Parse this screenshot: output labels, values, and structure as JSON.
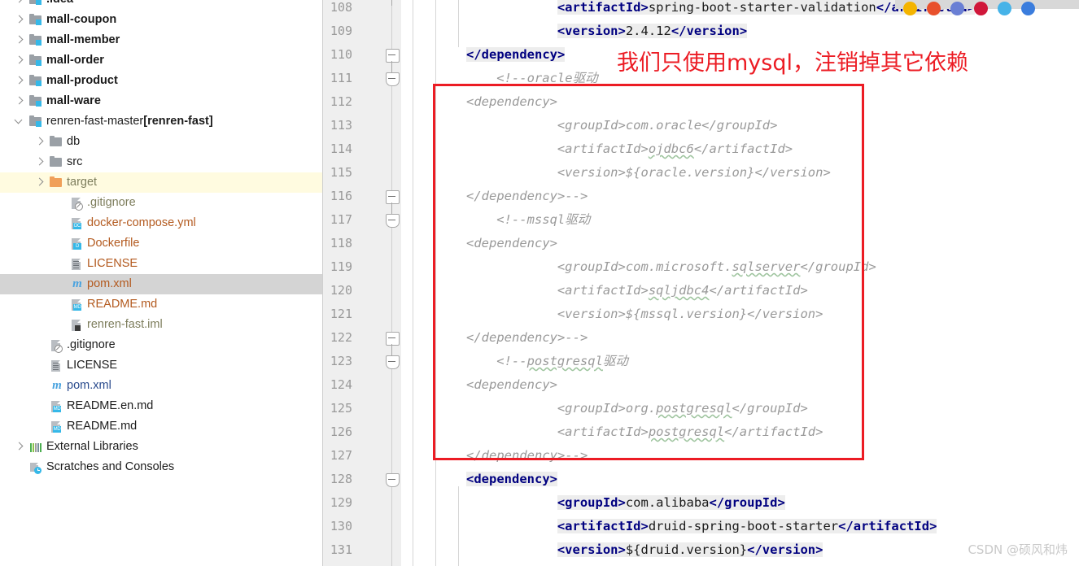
{
  "sidebar": {
    "rows": [
      {
        "label": ".idea",
        "indent": 0,
        "icon": "folder-module-icon",
        "arrow": "closed",
        "style": "bold-dark",
        "state": "clipped"
      },
      {
        "label": "mall-coupon",
        "indent": 0,
        "icon": "folder-module-icon",
        "arrow": "closed",
        "style": "bold-dark",
        "state": "normal"
      },
      {
        "label": "mall-member",
        "indent": 0,
        "icon": "folder-module-icon",
        "arrow": "closed",
        "style": "bold-dark",
        "state": "normal"
      },
      {
        "label": "mall-order",
        "indent": 0,
        "icon": "folder-module-icon",
        "arrow": "closed",
        "style": "bold-dark",
        "state": "normal"
      },
      {
        "label": "mall-product",
        "indent": 0,
        "icon": "folder-module-icon",
        "arrow": "closed",
        "style": "bold-dark",
        "state": "normal"
      },
      {
        "label": "mall-ware",
        "indent": 0,
        "icon": "folder-module-icon",
        "arrow": "closed",
        "style": "bold-dark",
        "state": "normal"
      },
      {
        "label": "renren-fast-master ",
        "suffix": "[renren-fast]",
        "indent": 0,
        "icon": "folder-module-icon",
        "arrow": "open",
        "style": "dark-suffix-bold",
        "state": "normal"
      },
      {
        "label": "db",
        "indent": 1,
        "icon": "folder-icon",
        "arrow": "closed",
        "style": "dark",
        "state": "normal"
      },
      {
        "label": "src",
        "indent": 1,
        "icon": "folder-icon",
        "arrow": "closed",
        "style": "dark",
        "state": "normal"
      },
      {
        "label": "target",
        "indent": 1,
        "icon": "folder-orange-icon",
        "arrow": "closed",
        "style": "olive",
        "state": "highlighted"
      },
      {
        "label": ".gitignore",
        "indent": 2,
        "icon": "gitignore-file-icon",
        "arrow": "none",
        "style": "olive",
        "state": "normal"
      },
      {
        "label": "docker-compose.yml",
        "indent": 2,
        "icon": "docker-compose-file-icon",
        "badge": "DC",
        "arrow": "none",
        "style": "orange",
        "state": "normal"
      },
      {
        "label": "Dockerfile",
        "indent": 2,
        "icon": "dockerfile-icon",
        "badge": "D",
        "arrow": "none",
        "style": "orange",
        "state": "normal"
      },
      {
        "label": "LICENSE",
        "indent": 2,
        "icon": "license-file-icon",
        "arrow": "none",
        "style": "orange",
        "state": "normal"
      },
      {
        "label": "pom.xml",
        "indent": 2,
        "icon": "maven-pom-icon",
        "arrow": "none",
        "style": "orange",
        "state": "selected"
      },
      {
        "label": "README.md",
        "indent": 2,
        "icon": "markdown-file-icon",
        "badge": "MD",
        "arrow": "none",
        "style": "orange",
        "state": "normal"
      },
      {
        "label": "renren-fast.iml",
        "indent": 2,
        "icon": "iml-file-icon",
        "arrow": "none",
        "style": "olive",
        "state": "normal"
      },
      {
        "label": ".gitignore",
        "indent": 1,
        "icon": "gitignore-file-icon",
        "arrow": "none",
        "style": "dark",
        "state": "normal"
      },
      {
        "label": "LICENSE",
        "indent": 1,
        "icon": "license-file-icon",
        "arrow": "none",
        "style": "dark",
        "state": "normal"
      },
      {
        "label": "pom.xml",
        "indent": 1,
        "icon": "maven-pom-icon",
        "arrow": "none",
        "style": "blue",
        "state": "normal"
      },
      {
        "label": "README.en.md",
        "indent": 1,
        "icon": "markdown-file-icon",
        "badge": "MD",
        "arrow": "none",
        "style": "dark",
        "state": "normal"
      },
      {
        "label": "README.md",
        "indent": 1,
        "icon": "markdown-file-icon",
        "badge": "MD",
        "arrow": "none",
        "style": "dark",
        "state": "normal"
      },
      {
        "label": "External Libraries",
        "indent": 0,
        "icon": "external-libraries-icon",
        "arrow": "closed",
        "style": "dark",
        "state": "normal"
      },
      {
        "label": "Scratches and Consoles",
        "indent": 0,
        "icon": "scratches-consoles-icon",
        "arrow": "none",
        "style": "dark",
        "state": "normal"
      }
    ]
  },
  "editor": {
    "first_line_number": 108,
    "line_numbers": [
      108,
      109,
      110,
      111,
      112,
      113,
      114,
      115,
      116,
      117,
      118,
      119,
      120,
      121,
      122,
      123,
      124,
      125,
      126,
      127,
      128,
      129,
      130,
      131
    ],
    "fold_markers": [
      {
        "line": 110,
        "type": "collapse"
      },
      {
        "line": 111,
        "type": "collapse-tip"
      },
      {
        "line": 116,
        "type": "collapse"
      },
      {
        "line": 117,
        "type": "collapse-tip"
      },
      {
        "line": 122,
        "type": "collapse"
      },
      {
        "line": 123,
        "type": "collapse-tip"
      },
      {
        "line": 128,
        "type": "collapse-tip"
      }
    ],
    "lines": [
      {
        "n": 108,
        "indent": 12,
        "parts": [
          {
            "t": "tag",
            "s": "<artifactId>"
          },
          {
            "t": "val",
            "s": "spring-boot-starter-validation"
          },
          {
            "t": "tag",
            "s": "</artifactId>"
          }
        ]
      },
      {
        "n": 109,
        "indent": 12,
        "parts": [
          {
            "t": "tag",
            "s": "<version>"
          },
          {
            "t": "val",
            "s": "2.4.12"
          },
          {
            "t": "tag",
            "s": "</version>"
          }
        ]
      },
      {
        "n": 110,
        "indent": 0,
        "parts": [
          {
            "t": "tag",
            "s": "</dependency>"
          }
        ]
      },
      {
        "n": 111,
        "indent": 4,
        "parts": [
          {
            "t": "cmt",
            "s": "<!--oracle"
          },
          {
            "t": "cmt",
            "s": "驱动"
          }
        ]
      },
      {
        "n": 112,
        "indent": 0,
        "parts": [
          {
            "t": "cmt",
            "s": "<dependency>"
          }
        ]
      },
      {
        "n": 113,
        "indent": 12,
        "parts": [
          {
            "t": "cmt",
            "s": "<groupId>com.oracle</groupId>"
          }
        ]
      },
      {
        "n": 114,
        "indent": 12,
        "parts": [
          {
            "t": "cmt",
            "s": "<artifactId>"
          },
          {
            "t": "cmt-u",
            "s": "ojdbc6"
          },
          {
            "t": "cmt",
            "s": "</artifactId>"
          }
        ]
      },
      {
        "n": 115,
        "indent": 12,
        "parts": [
          {
            "t": "cmt",
            "s": "<version>${oracle.version}</version>"
          }
        ]
      },
      {
        "n": 116,
        "indent": 0,
        "parts": [
          {
            "t": "cmt",
            "s": "</dependency>-->"
          }
        ]
      },
      {
        "n": 117,
        "indent": 4,
        "parts": [
          {
            "t": "cmt",
            "s": "<!--mssql"
          },
          {
            "t": "cmt",
            "s": "驱动"
          }
        ]
      },
      {
        "n": 118,
        "indent": 0,
        "parts": [
          {
            "t": "cmt",
            "s": "<dependency>"
          }
        ]
      },
      {
        "n": 119,
        "indent": 12,
        "parts": [
          {
            "t": "cmt",
            "s": "<groupId>com.microsoft."
          },
          {
            "t": "cmt-u",
            "s": "sqlserver"
          },
          {
            "t": "cmt",
            "s": "</groupId>"
          }
        ]
      },
      {
        "n": 120,
        "indent": 12,
        "parts": [
          {
            "t": "cmt",
            "s": "<artifactId>"
          },
          {
            "t": "cmt-u",
            "s": "sqljdbc4"
          },
          {
            "t": "cmt",
            "s": "</artifactId>"
          }
        ]
      },
      {
        "n": 121,
        "indent": 12,
        "parts": [
          {
            "t": "cmt",
            "s": "<version>${mssql.version}</version>"
          }
        ]
      },
      {
        "n": 122,
        "indent": 0,
        "parts": [
          {
            "t": "cmt",
            "s": "</dependency>-->"
          }
        ]
      },
      {
        "n": 123,
        "indent": 4,
        "parts": [
          {
            "t": "cmt",
            "s": "<!--"
          },
          {
            "t": "cmt-u",
            "s": "postgresql"
          },
          {
            "t": "cmt",
            "s": "驱动"
          }
        ]
      },
      {
        "n": 124,
        "indent": 0,
        "parts": [
          {
            "t": "cmt",
            "s": "<dependency>"
          }
        ]
      },
      {
        "n": 125,
        "indent": 12,
        "parts": [
          {
            "t": "cmt",
            "s": "<groupId>org."
          },
          {
            "t": "cmt-u",
            "s": "postgresql"
          },
          {
            "t": "cmt",
            "s": "</groupId>"
          }
        ]
      },
      {
        "n": 126,
        "indent": 12,
        "parts": [
          {
            "t": "cmt",
            "s": "<artifactId>"
          },
          {
            "t": "cmt-u",
            "s": "postgresql"
          },
          {
            "t": "cmt",
            "s": "</artifactId>"
          }
        ]
      },
      {
        "n": 127,
        "indent": 0,
        "parts": [
          {
            "t": "cmt",
            "s": "</dependency>-->"
          }
        ]
      },
      {
        "n": 128,
        "indent": 0,
        "parts": [
          {
            "t": "tag",
            "s": "<dependency>"
          }
        ]
      },
      {
        "n": 129,
        "indent": 12,
        "parts": [
          {
            "t": "tag",
            "s": "<groupId>"
          },
          {
            "t": "val",
            "s": "com.alibaba"
          },
          {
            "t": "tag",
            "s": "</groupId>"
          }
        ]
      },
      {
        "n": 130,
        "indent": 12,
        "parts": [
          {
            "t": "tag",
            "s": "<artifactId>"
          },
          {
            "t": "val",
            "s": "druid-spring-boot-starter"
          },
          {
            "t": "tag",
            "s": "</artifactId>"
          }
        ]
      },
      {
        "n": 131,
        "indent": 12,
        "parts": [
          {
            "t": "tag",
            "s": "<version>"
          },
          {
            "t": "val",
            "s": "${druid.version}"
          },
          {
            "t": "tag",
            "s": "</version>"
          }
        ]
      }
    ]
  },
  "annotation": {
    "text": "我们只使用mysql，注销掉其它依赖",
    "color": "#ec1c24",
    "box_color": "#ec1c24"
  },
  "top_icons": [
    {
      "name": "chrome-icon",
      "color": "#f4b400"
    },
    {
      "name": "firefox-icon",
      "color": "#e8502c"
    },
    {
      "name": "edge-icon",
      "color": "#6a7fd4"
    },
    {
      "name": "opera-icon",
      "color": "#d0173a"
    },
    {
      "name": "twitter-icon",
      "color": "#46b3e8"
    },
    {
      "name": "app-icon",
      "color": "#3b7ddd"
    }
  ],
  "watermark": {
    "text": "CSDN @硕风和炜"
  },
  "colors": {
    "selection": "#d4d4d4",
    "highlight_row": "#fffbe0",
    "gutter": "#efefef",
    "tag": "#000080",
    "comment": "#9a9a9a",
    "accent_red": "#ec1c24"
  }
}
